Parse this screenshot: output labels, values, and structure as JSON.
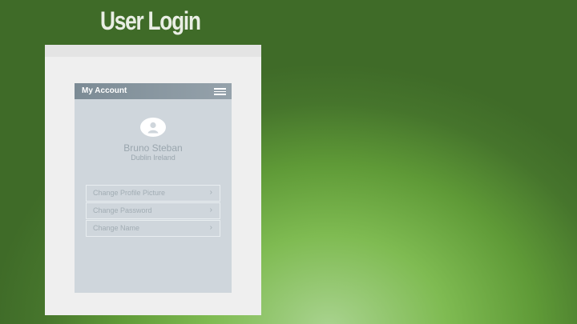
{
  "slide": {
    "title": "User Login"
  },
  "app": {
    "header_title": "My Account",
    "user": {
      "name": "Bruno Steban",
      "location": "Dublin Ireland"
    },
    "menu_items": [
      {
        "label": "Change Profile Picture",
        "chevron": "›"
      },
      {
        "label": "Change Password",
        "chevron": "›"
      },
      {
        "label": "Change Name",
        "chevron": "›"
      }
    ]
  },
  "icons": {
    "menu": "hamburger-icon",
    "avatar": "user-avatar-icon",
    "chevron": "chevron-right-icon"
  },
  "colors": {
    "header": "#7c8b95",
    "panel": "#cfd6dc",
    "background": "#5f9a37"
  }
}
